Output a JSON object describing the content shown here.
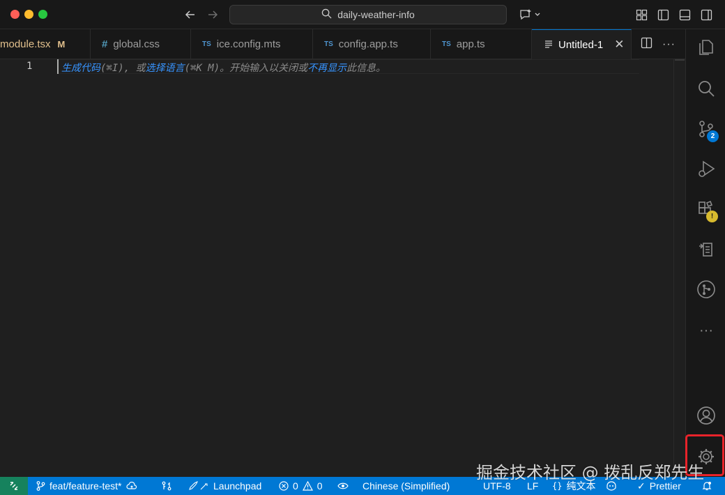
{
  "window": {
    "search_text": "daily-weather-info"
  },
  "tabs": [
    {
      "label": "module.tsx",
      "badge": "M"
    },
    {
      "label": "global.css",
      "icon": "css-hash-icon"
    },
    {
      "label": "ice.config.mts",
      "icon_text": "TS"
    },
    {
      "label": "config.app.ts",
      "icon_text": "TS"
    },
    {
      "label": "app.ts",
      "icon_text": "TS"
    },
    {
      "label": "Untitled-1",
      "active": true
    }
  ],
  "editor": {
    "line_number": "1",
    "hint": {
      "part1": "生成代码",
      "part2": "(⌘I), 或",
      "part3": "选择语言",
      "part4": "(⌘K M)。开始输入以关闭或",
      "part5": "不再显示",
      "part6": "此信息。"
    }
  },
  "activity": {
    "scm_badge": "2",
    "extensions_badge": "!"
  },
  "statusbar": {
    "branch": "feat/feature-test*",
    "launchpad": "Launchpad",
    "errors": "0",
    "warnings": "0",
    "language_pack": "Chinese (Simplified)",
    "encoding": "UTF-8",
    "eol": "LF",
    "language_mode": "纯文本",
    "prettier": "Prettier"
  },
  "watermark": "掘金技术社区 @ 拨乱反郑先生",
  "colors": {
    "accent": "#0078d4",
    "remote": "#16825d",
    "highlight": "#e8232a"
  }
}
